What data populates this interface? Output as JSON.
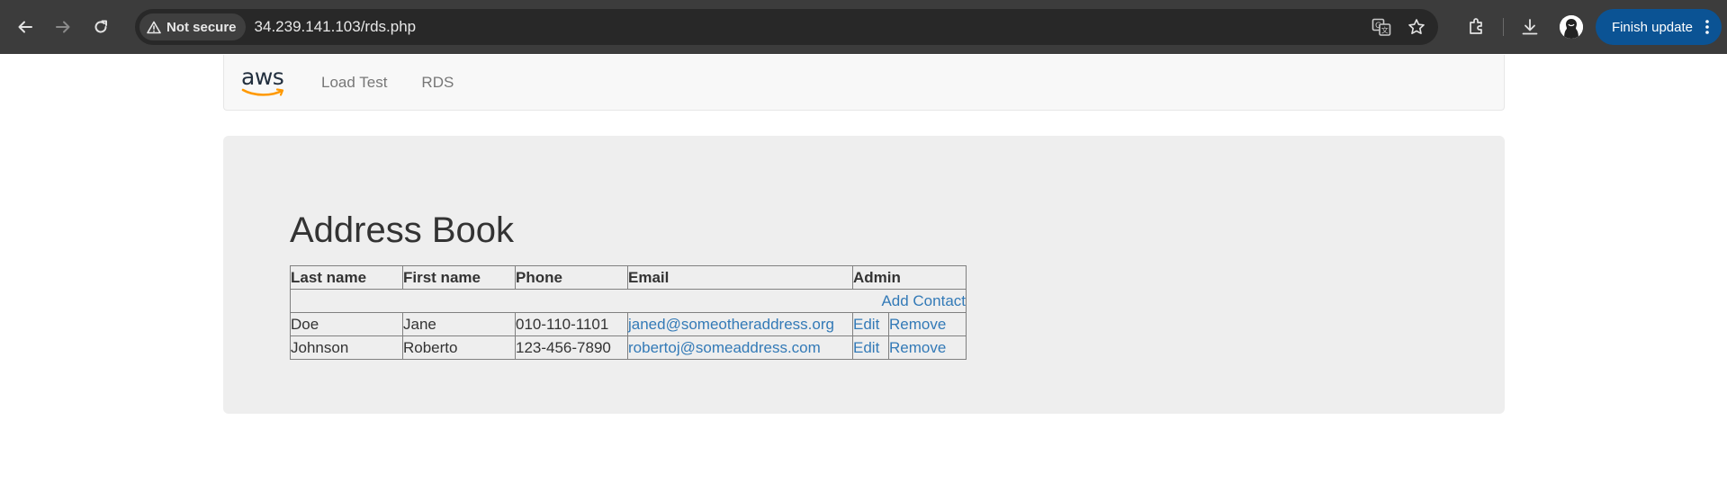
{
  "browser": {
    "security_label": "Not secure",
    "url": "34.239.141.103/rds.php",
    "finish_update_label": "Finish update"
  },
  "navbar": {
    "brand": "aws",
    "links": [
      {
        "label": "Load Test"
      },
      {
        "label": "RDS"
      }
    ]
  },
  "main": {
    "title": "Address Book",
    "table": {
      "headers": {
        "last_name": "Last name",
        "first_name": "First name",
        "phone": "Phone",
        "email": "Email",
        "admin": "Admin"
      },
      "add_contact_label": "Add Contact",
      "rows": [
        {
          "last_name": "Doe",
          "first_name": "Jane",
          "phone": "010-110-1101",
          "email": "janed@someotheraddress.org",
          "edit": "Edit",
          "remove": "Remove"
        },
        {
          "last_name": "Johnson",
          "first_name": "Roberto",
          "phone": "123-456-7890",
          "email": "robertoj@someaddress.com",
          "edit": "Edit",
          "remove": "Remove"
        }
      ]
    }
  },
  "colors": {
    "chrome_bg": "#3c3c3c",
    "link": "#337ab7",
    "jumbotron_bg": "#eeeeee",
    "update_button": "#0b5394",
    "aws_smile": "#ff9900"
  }
}
